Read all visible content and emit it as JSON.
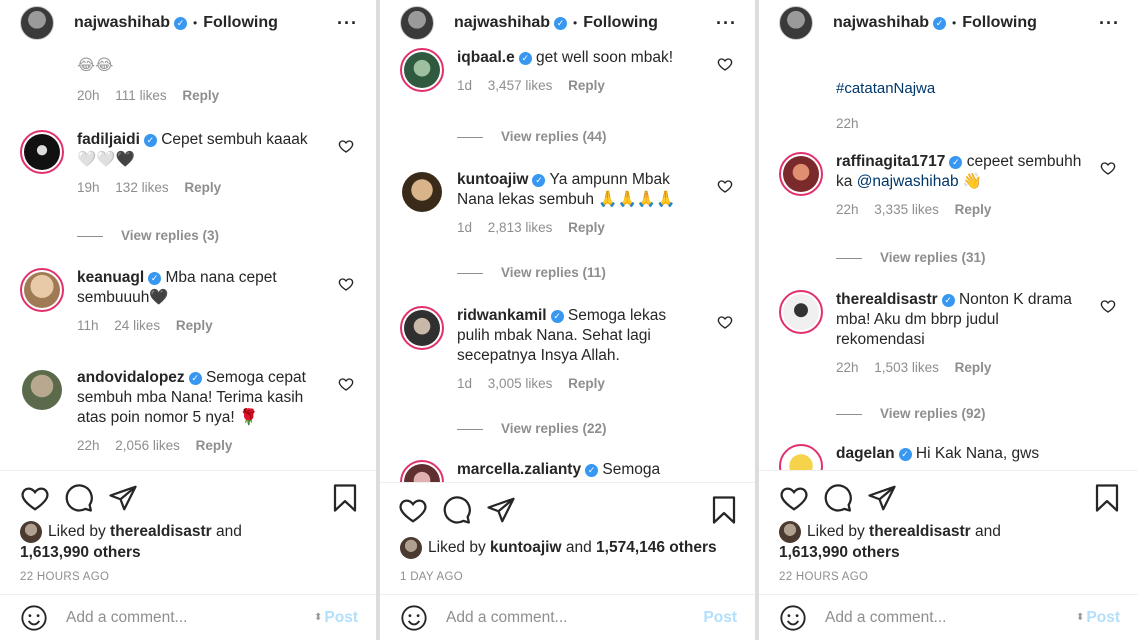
{
  "panels": [
    {
      "header": {
        "username": "najwashihab",
        "dot": "•",
        "following": "Following",
        "more": "···"
      },
      "comments": {
        "top_fragment": {
          "text": "😂😂",
          "time": "20h",
          "likes": "111 likes",
          "reply": "Reply"
        },
        "items": [
          {
            "username": "fadiljaidi",
            "text": "Cepet sembuh kaaak 🤍🤍🖤",
            "time": "19h",
            "likes": "132 likes",
            "reply": "Reply",
            "view_replies": "View replies (3)"
          },
          {
            "username": "keanuagl",
            "text": "Mba nana cepet sembuuuh🖤",
            "time": "11h",
            "likes": "24 likes",
            "reply": "Reply"
          },
          {
            "username": "andovidalopez",
            "text": "Semoga cepat sembuh mba Nana! Terima kasih atas poin nomor 5 nya! 🌹",
            "time": "22h",
            "likes": "2,056 likes",
            "reply": "Reply"
          }
        ]
      },
      "likes": {
        "prefix": "Liked by",
        "user": "therealdisastr",
        "and": "and",
        "count": "1,613,990 others"
      },
      "ago": "22 HOURS AGO",
      "add_comment": {
        "placeholder": "Add a comment...",
        "post": "Post"
      }
    },
    {
      "header": {
        "username": "najwashihab",
        "dot": "•",
        "following": "Following",
        "more": "···"
      },
      "comments": {
        "items": [
          {
            "username": "iqbaal.e",
            "text": "get well soon mbak!",
            "time": "1d",
            "likes": "3,457 likes",
            "reply": "Reply",
            "view_replies": "View replies (44)"
          },
          {
            "username": "kuntoajiw",
            "text": "Ya ampunn Mbak Nana lekas sembuh 🙏🙏🙏🙏",
            "time": "1d",
            "likes": "2,813 likes",
            "reply": "Reply",
            "view_replies": "View replies (11)"
          },
          {
            "username": "ridwankamil",
            "text": "Semoga lekas pulih mbak Nana. Sehat lagi secepatnya Insya Allah.",
            "time": "1d",
            "likes": "3,005 likes",
            "reply": "Reply",
            "view_replies": "View replies (22)"
          },
          {
            "username": "marcella.zalianty",
            "text": "Semoga"
          }
        ]
      },
      "likes": {
        "prefix": "Liked by",
        "user": "kuntoajiw",
        "and": "and",
        "count": "1,574,146 others"
      },
      "ago": "1 DAY AGO",
      "add_comment": {
        "placeholder": "Add a comment...",
        "post": "Post"
      }
    },
    {
      "header": {
        "username": "najwashihab",
        "dot": "•",
        "following": "Following",
        "more": "···"
      },
      "comments": {
        "hashtag": "#catatanNajwa",
        "caption_time": "22h",
        "items": [
          {
            "username": "raffinagita1717",
            "text": "cepeet sembuhh ka",
            "mention": "@najwashihab",
            "emoji": "👋",
            "time": "22h",
            "likes": "3,335 likes",
            "reply": "Reply",
            "view_replies": "View replies (31)"
          },
          {
            "username": "therealdisastr",
            "text": "Nonton K drama mba! Aku dm bbrp judul rekomendasi",
            "time": "22h",
            "likes": "1,503 likes",
            "reply": "Reply",
            "view_replies": "View replies (92)"
          },
          {
            "username": "dagelan",
            "text": "Hi Kak Nana, gws"
          }
        ]
      },
      "likes": {
        "prefix": "Liked by",
        "user": "therealdisastr",
        "and": "and",
        "count": "1,613,990 others"
      },
      "ago": "22 HOURS AGO",
      "add_comment": {
        "placeholder": "Add a comment...",
        "post": "Post"
      }
    }
  ],
  "icons": {
    "avatar": "profile-avatar",
    "verified": "verified-badge-icon",
    "heart": "heart-icon",
    "comment": "comment-icon",
    "share": "paper-plane-icon",
    "save": "bookmark-icon",
    "emoji": "smiley-icon"
  },
  "colors": {
    "verified": "#3897f0",
    "link": "#00376b",
    "muted": "#8e8e8e",
    "post_disabled": "#b2dffc",
    "story_ring": "#e1306c"
  }
}
